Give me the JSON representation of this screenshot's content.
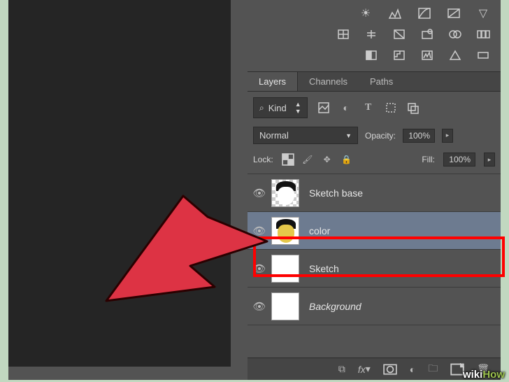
{
  "tabs": {
    "layers": "Layers",
    "channels": "Channels",
    "paths": "Paths"
  },
  "filter": {
    "kind": "Kind"
  },
  "blend": {
    "mode": "Normal",
    "opacityLabel": "Opacity:",
    "opacityValue": "100%"
  },
  "lock": {
    "label": "Lock:",
    "fillLabel": "Fill:",
    "fillValue": "100%"
  },
  "layers": [
    {
      "name": "Sketch base"
    },
    {
      "name": "color"
    },
    {
      "name": "Sketch"
    },
    {
      "name": "Background"
    }
  ],
  "watermark": {
    "pre": "wiki",
    "post": "How"
  }
}
